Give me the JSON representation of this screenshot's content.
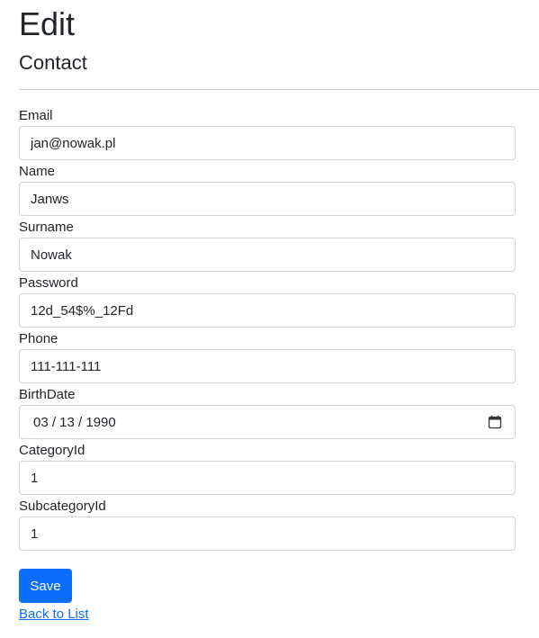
{
  "header": {
    "title": "Edit",
    "subtitle": "Contact"
  },
  "form": {
    "email": {
      "label": "Email",
      "value": "jan@nowak.pl"
    },
    "name": {
      "label": "Name",
      "value": "Janws"
    },
    "surname": {
      "label": "Surname",
      "value": "Nowak"
    },
    "password": {
      "label": "Password",
      "value": "12d_54$%_12Fd"
    },
    "phone": {
      "label": "Phone",
      "value": "111-111-111"
    },
    "birthdate": {
      "label": "BirthDate",
      "value": "03 / 13 / 1990",
      "icon": "calendar-icon"
    },
    "category_id": {
      "label": "CategoryId",
      "value": "1"
    },
    "subcategory_id": {
      "label": "SubcategoryId",
      "value": "1"
    }
  },
  "actions": {
    "save_label": "Save",
    "back_label": "Back to List"
  },
  "colors": {
    "primary": "#0d6efd",
    "text": "#212529",
    "border": "#ced4da"
  }
}
